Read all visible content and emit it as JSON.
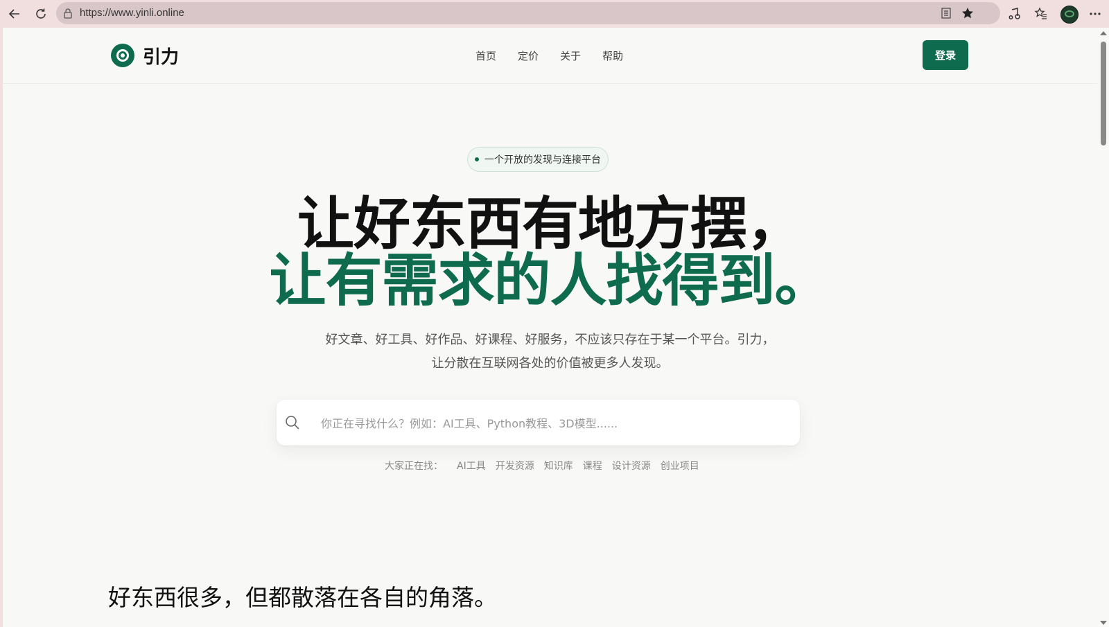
{
  "browser": {
    "url": "https://www.yinli.online"
  },
  "header": {
    "logo_text": "引力",
    "nav": [
      "首页",
      "定价",
      "关于",
      "帮助"
    ],
    "login_label": "登录"
  },
  "hero": {
    "badge": "一个开放的发现与连接平台",
    "headline_line1": "让好东西有地方摆，",
    "headline_line2": "让有需求的人找得到。",
    "subtitle_line1": "好文章、好工具、好作品、好课程、好服务，不应该只存在于某一个平台。引力，",
    "subtitle_line2": "让分散在互联网各处的价值被更多人发现。"
  },
  "search": {
    "placeholder": "你正在寻找什么？例如：AI工具、Python教程、3D模型......"
  },
  "trending": {
    "label": "大家正在找：",
    "tags": [
      "AI工具",
      "开发资源",
      "知识库",
      "课程",
      "设计资源",
      "创业项目"
    ]
  },
  "section": {
    "title": "好东西很多，但都散落在各自的角落。"
  },
  "colors": {
    "brand": "#0e6b4e",
    "text": "#111111",
    "background": "#f8f8f6"
  }
}
